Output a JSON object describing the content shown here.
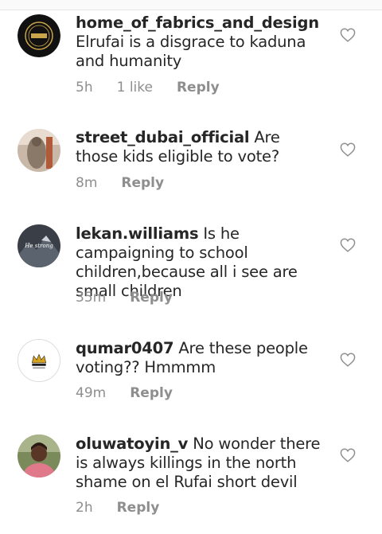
{
  "comments": [
    {
      "username": "home_of_fabrics_and_design",
      "text": "Elrufai is a disgrace to kaduna and humanity",
      "time": "5h",
      "likes": "1 like",
      "reply_label": "Reply",
      "avatar_icon": "black-gold-logo-avatar"
    },
    {
      "username": "street_dubai_official",
      "text": "Are those kids eligible to vote?",
      "time": "8m",
      "likes": "",
      "reply_label": "Reply",
      "avatar_icon": "photo-avatar"
    },
    {
      "username": "lekan.williams",
      "text": "Is he campaigning to school children,because all i see are small children",
      "time": "35m",
      "likes": "",
      "reply_label": "Reply",
      "avatar_icon": "mountain-photo-avatar",
      "avatar_text": "He strong"
    },
    {
      "username": "qumar0407",
      "text": "Are these people voting?? Hmmmm",
      "time": "49m",
      "likes": "",
      "reply_label": "Reply",
      "avatar_icon": "crown-logo-avatar"
    },
    {
      "username": "oluwatoyin_v",
      "text": "No wonder there is always killings in the north shame on el Rufai short devil",
      "time": "2h",
      "likes": "",
      "reply_label": "Reply",
      "avatar_icon": "person-photo-avatar"
    }
  ]
}
